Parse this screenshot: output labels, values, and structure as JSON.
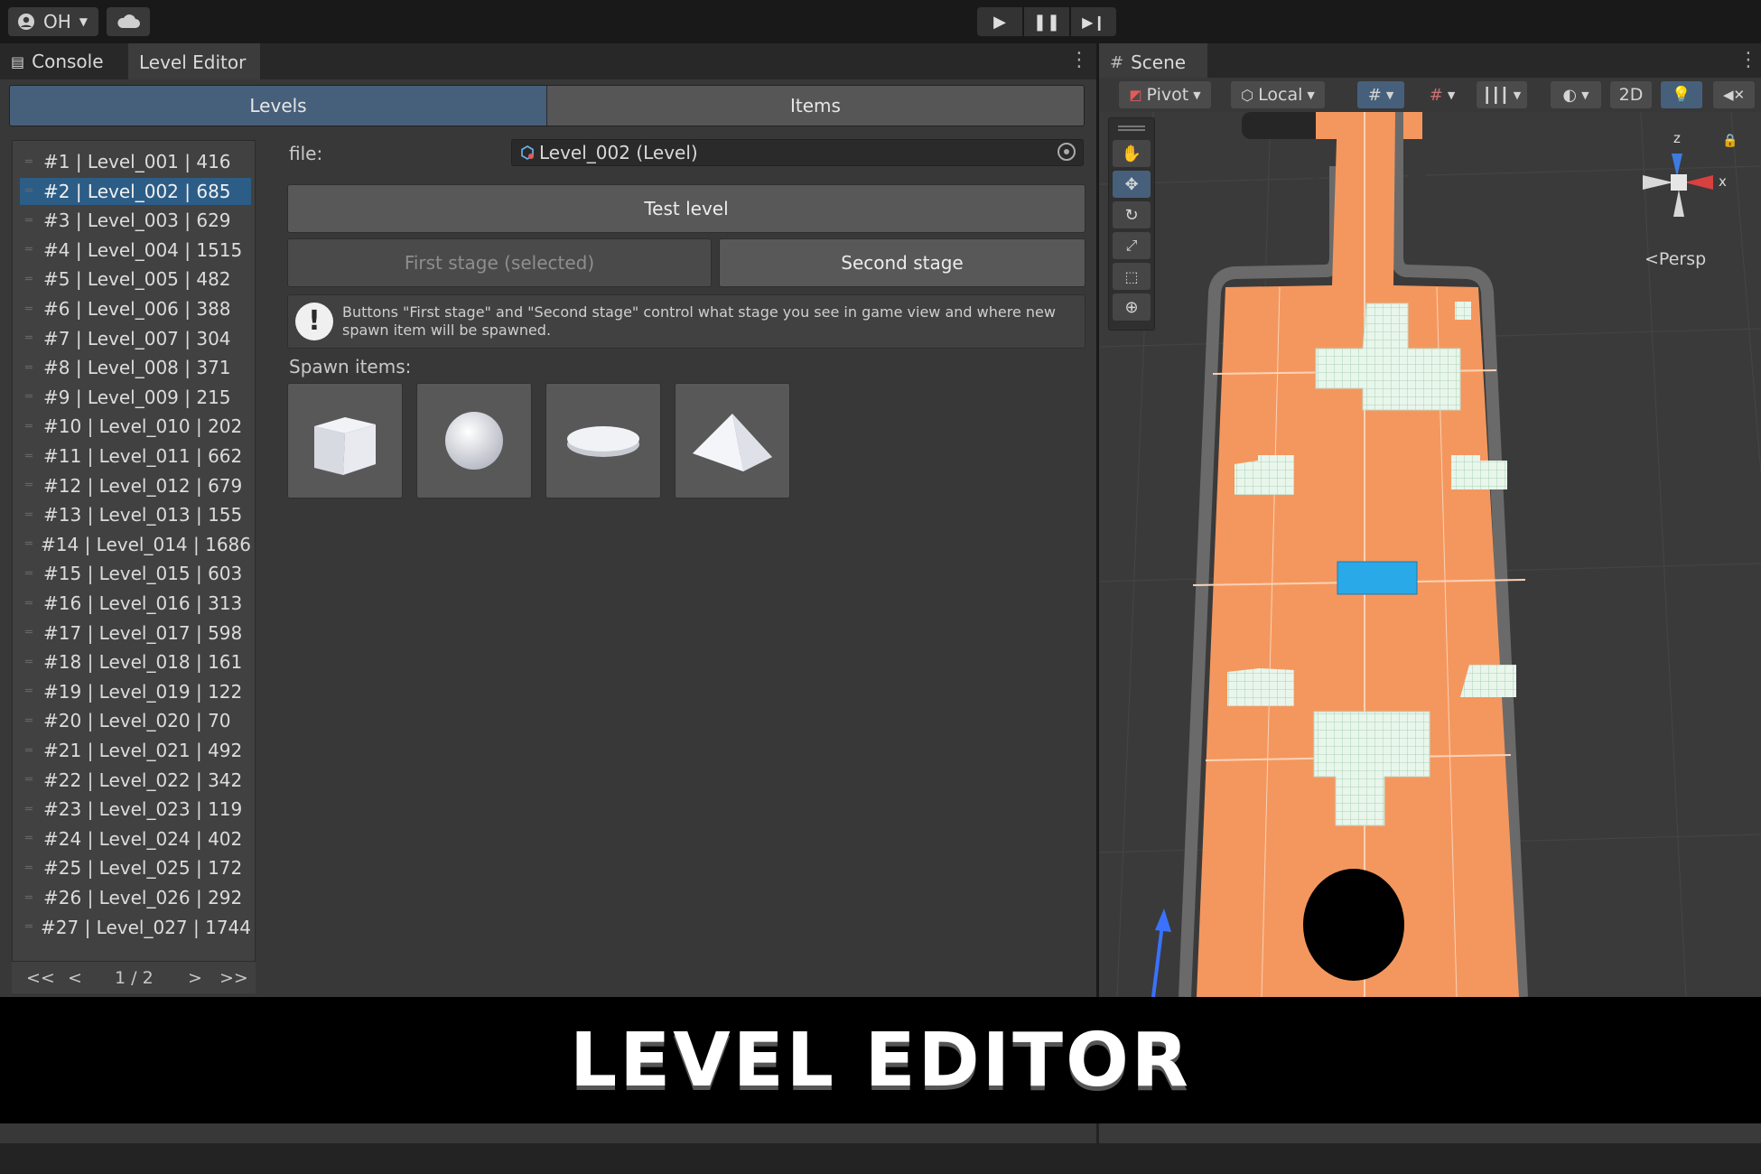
{
  "topbar": {
    "account": "OH",
    "account_icon": "user-circle-icon",
    "cloud_icon": "cloud-icon"
  },
  "left_tabs": [
    {
      "label": "Console",
      "icon": "console-icon"
    },
    {
      "label": "Level Editor"
    }
  ],
  "scene_tab": {
    "label": "Scene",
    "icon": "grid-icon"
  },
  "segments": {
    "levels": "Levels",
    "items": "Items"
  },
  "levels": [
    {
      "label": "#1 | Level_001 | 416"
    },
    {
      "label": "#2 | Level_002 | 685",
      "selected": true
    },
    {
      "label": "#3 | Level_003 | 629"
    },
    {
      "label": "#4 | Level_004 | 1515"
    },
    {
      "label": "#5 | Level_005 | 482"
    },
    {
      "label": "#6 | Level_006 | 388"
    },
    {
      "label": "#7 | Level_007 | 304"
    },
    {
      "label": "#8 | Level_008 | 371"
    },
    {
      "label": "#9 | Level_009 | 215"
    },
    {
      "label": "#10 | Level_010 | 202"
    },
    {
      "label": "#11 | Level_011 | 662"
    },
    {
      "label": "#12 | Level_012 | 679"
    },
    {
      "label": "#13 | Level_013 | 155"
    },
    {
      "label": "#14 | Level_014 | 1686"
    },
    {
      "label": "#15 | Level_015 | 603"
    },
    {
      "label": "#16 | Level_016 | 313"
    },
    {
      "label": "#17 | Level_017 | 598"
    },
    {
      "label": "#18 | Level_018 | 161"
    },
    {
      "label": "#19 | Level_019 | 122"
    },
    {
      "label": "#20 | Level_020 | 70"
    },
    {
      "label": "#21 | Level_021 | 492"
    },
    {
      "label": "#22 | Level_022 | 342"
    },
    {
      "label": "#23 | Level_023 | 119"
    },
    {
      "label": "#24 | Level_024 | 402"
    },
    {
      "label": "#25 | Level_025 | 172"
    },
    {
      "label": "#26 | Level_026 | 292"
    },
    {
      "label": "#27 | Level_027 | 1744"
    }
  ],
  "pager": {
    "first": "<<",
    "prev": "<",
    "page": "1 / 2",
    "next": ">",
    "last": ">>"
  },
  "editor": {
    "file_label": "file:",
    "file_value": "Level_002 (Level)",
    "test_button": "Test level",
    "first_stage": "First stage (selected)",
    "second_stage": "Second stage",
    "help_text": "Buttons \"First stage\" and \"Second stage\" control what stage you see in game view and where new spawn item will be spawned.",
    "spawn_label": "Spawn items:",
    "spawn_items": [
      "cube-icon",
      "sphere-icon",
      "disc-icon",
      "pyramid-icon"
    ]
  },
  "scene_toolbar": {
    "pivot": "Pivot",
    "local": "Local",
    "mode_2d": "2D",
    "persp": "Persp",
    "axis_x": "x",
    "axis_z": "z"
  },
  "banner": "LEVEL EDITOR",
  "colors": {
    "accent": "#46607c",
    "selection": "#2c5d87",
    "floor": "#f4975e",
    "rail": "#6a6a6a"
  }
}
